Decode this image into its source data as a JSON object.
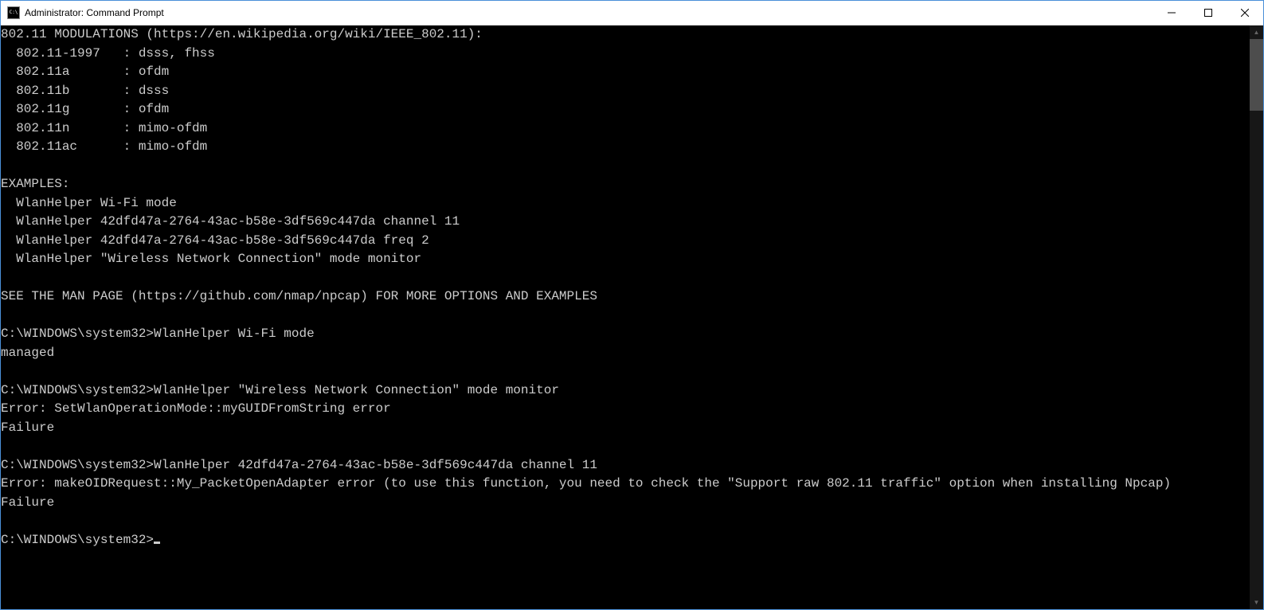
{
  "window": {
    "title": "Administrator: Command Prompt"
  },
  "console": {
    "content": "802.11 MODULATIONS (https://en.wikipedia.org/wiki/IEEE_802.11):\n  802.11-1997   : dsss, fhss\n  802.11a       : ofdm\n  802.11b       : dsss\n  802.11g       : ofdm\n  802.11n       : mimo-ofdm\n  802.11ac      : mimo-ofdm\n\nEXAMPLES:\n  WlanHelper Wi-Fi mode\n  WlanHelper 42dfd47a-2764-43ac-b58e-3df569c447da channel 11\n  WlanHelper 42dfd47a-2764-43ac-b58e-3df569c447da freq 2\n  WlanHelper \"Wireless Network Connection\" mode monitor\n\nSEE THE MAN PAGE (https://github.com/nmap/npcap) FOR MORE OPTIONS AND EXAMPLES\n\nC:\\WINDOWS\\system32>WlanHelper Wi-Fi mode\nmanaged\n\nC:\\WINDOWS\\system32>WlanHelper \"Wireless Network Connection\" mode monitor\nError: SetWlanOperationMode::myGUIDFromString error\nFailure\n\nC:\\WINDOWS\\system32>WlanHelper 42dfd47a-2764-43ac-b58e-3df569c447da channel 11\nError: makeOIDRequest::My_PacketOpenAdapter error (to use this function, you need to check the \"Support raw 802.11 traffic\" option when installing Npcap)\nFailure\n\nC:\\WINDOWS\\system32>"
  }
}
